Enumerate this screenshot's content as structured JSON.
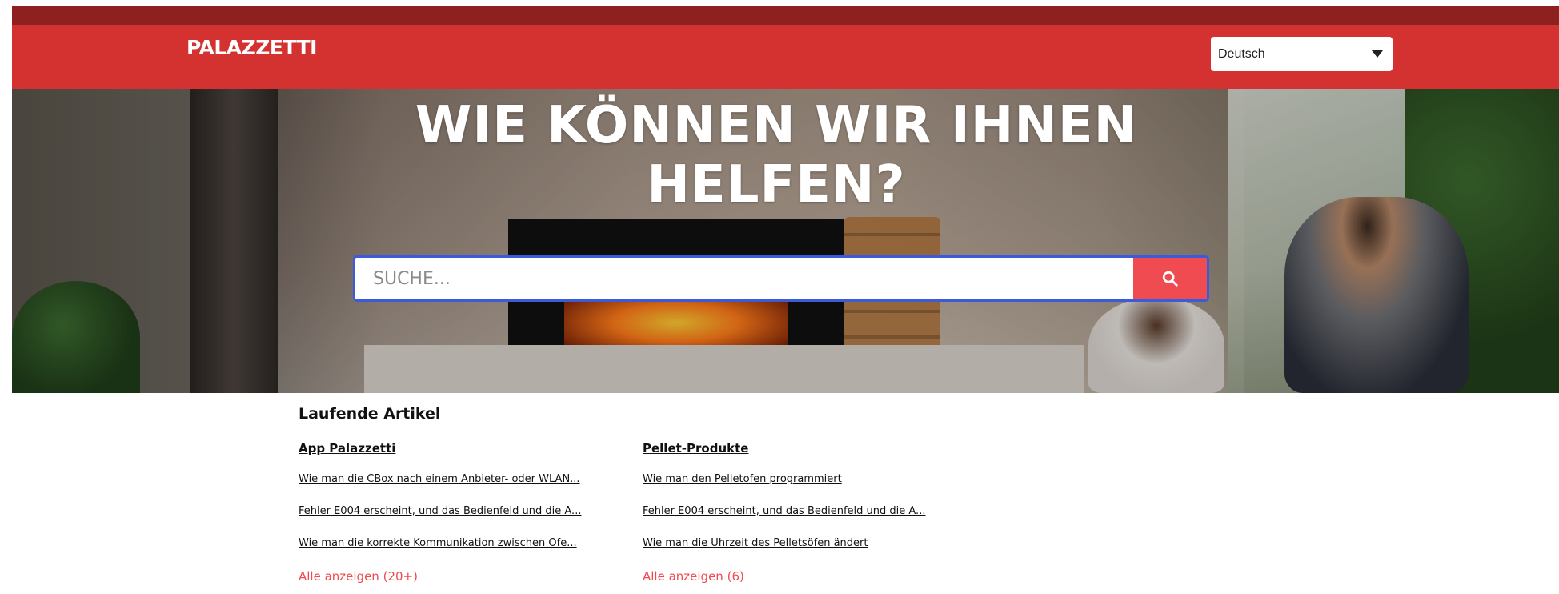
{
  "header": {
    "logo_text": "PALAZZETTI",
    "language_select": {
      "value": "Deutsch"
    }
  },
  "hero": {
    "title": "WIE KÖNNEN WIR IHNEN HELFEN?",
    "search": {
      "placeholder": "SUCHE...",
      "button_icon": "search-icon"
    }
  },
  "articles": {
    "title": "Laufende Artikel",
    "categories": [
      {
        "name": "App Palazzetti",
        "items": [
          "Wie man die CBox nach einem Anbieter- oder WLAN...",
          "Fehler E004 erscheint, und das Bedienfeld und die A...",
          "Wie man die korrekte Kommunikation zwischen Ofe..."
        ],
        "show_all": "Alle anzeigen (20+)"
      },
      {
        "name": "Pellet-Produkte",
        "items": [
          "Wie man den Pelletofen programmiert",
          "Fehler E004 erscheint, und das Bedienfeld und die A...",
          "Wie man die Uhrzeit des Pelletsöfen ändert"
        ],
        "show_all": "Alle anzeigen (6)"
      }
    ]
  },
  "colors": {
    "header_bg": "#d43131",
    "top_strip": "#8f2020",
    "accent": "#ef4b50",
    "focus_border": "#3b5bdb"
  }
}
